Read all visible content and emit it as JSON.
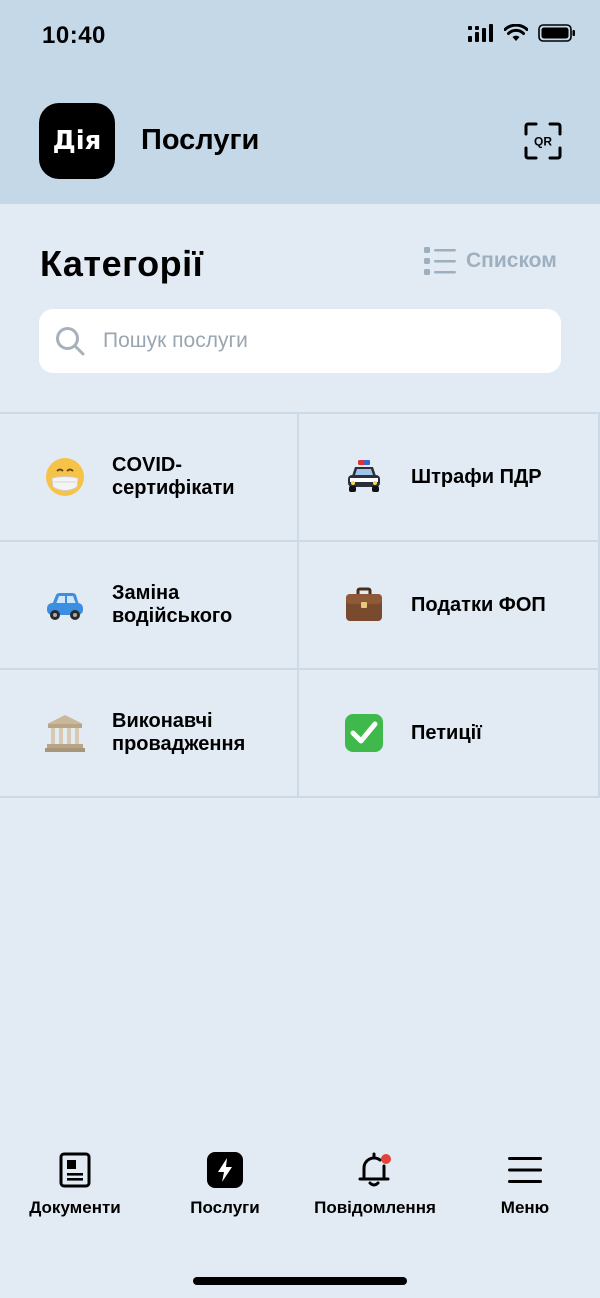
{
  "status_bar": {
    "time": "10:40"
  },
  "header": {
    "logo_text": "Дія",
    "title": "Послуги",
    "qr_label": "QR"
  },
  "section": {
    "title": "Категорії",
    "view_toggle_label": "Списком"
  },
  "search": {
    "placeholder": "Пошук послуги",
    "value": ""
  },
  "categories": [
    {
      "label": "COVID-\nсертифікати",
      "icon": "face-with-mask-icon"
    },
    {
      "label": "Штрафи ПДР",
      "icon": "police-car-icon"
    },
    {
      "label": "Заміна\nводійського",
      "icon": "car-icon"
    },
    {
      "label": "Податки ФОП",
      "icon": "briefcase-icon"
    },
    {
      "label": "Виконавчі\nпровадження",
      "icon": "classical-building-icon"
    },
    {
      "label": "Петиції",
      "icon": "check-mark-icon"
    }
  ],
  "tabbar": {
    "items": [
      {
        "label": "Документи",
        "icon": "document-icon"
      },
      {
        "label": "Послуги",
        "icon": "lightning-icon",
        "active": true
      },
      {
        "label": "Повідомлення",
        "icon": "bell-icon",
        "badge": true
      },
      {
        "label": "Меню",
        "icon": "hamburger-icon"
      }
    ]
  },
  "colors": {
    "header_bg": "#c5d8e8",
    "page_bg": "#e2ebf3",
    "badge": "#e5413b",
    "muted": "#9eb0c0"
  }
}
